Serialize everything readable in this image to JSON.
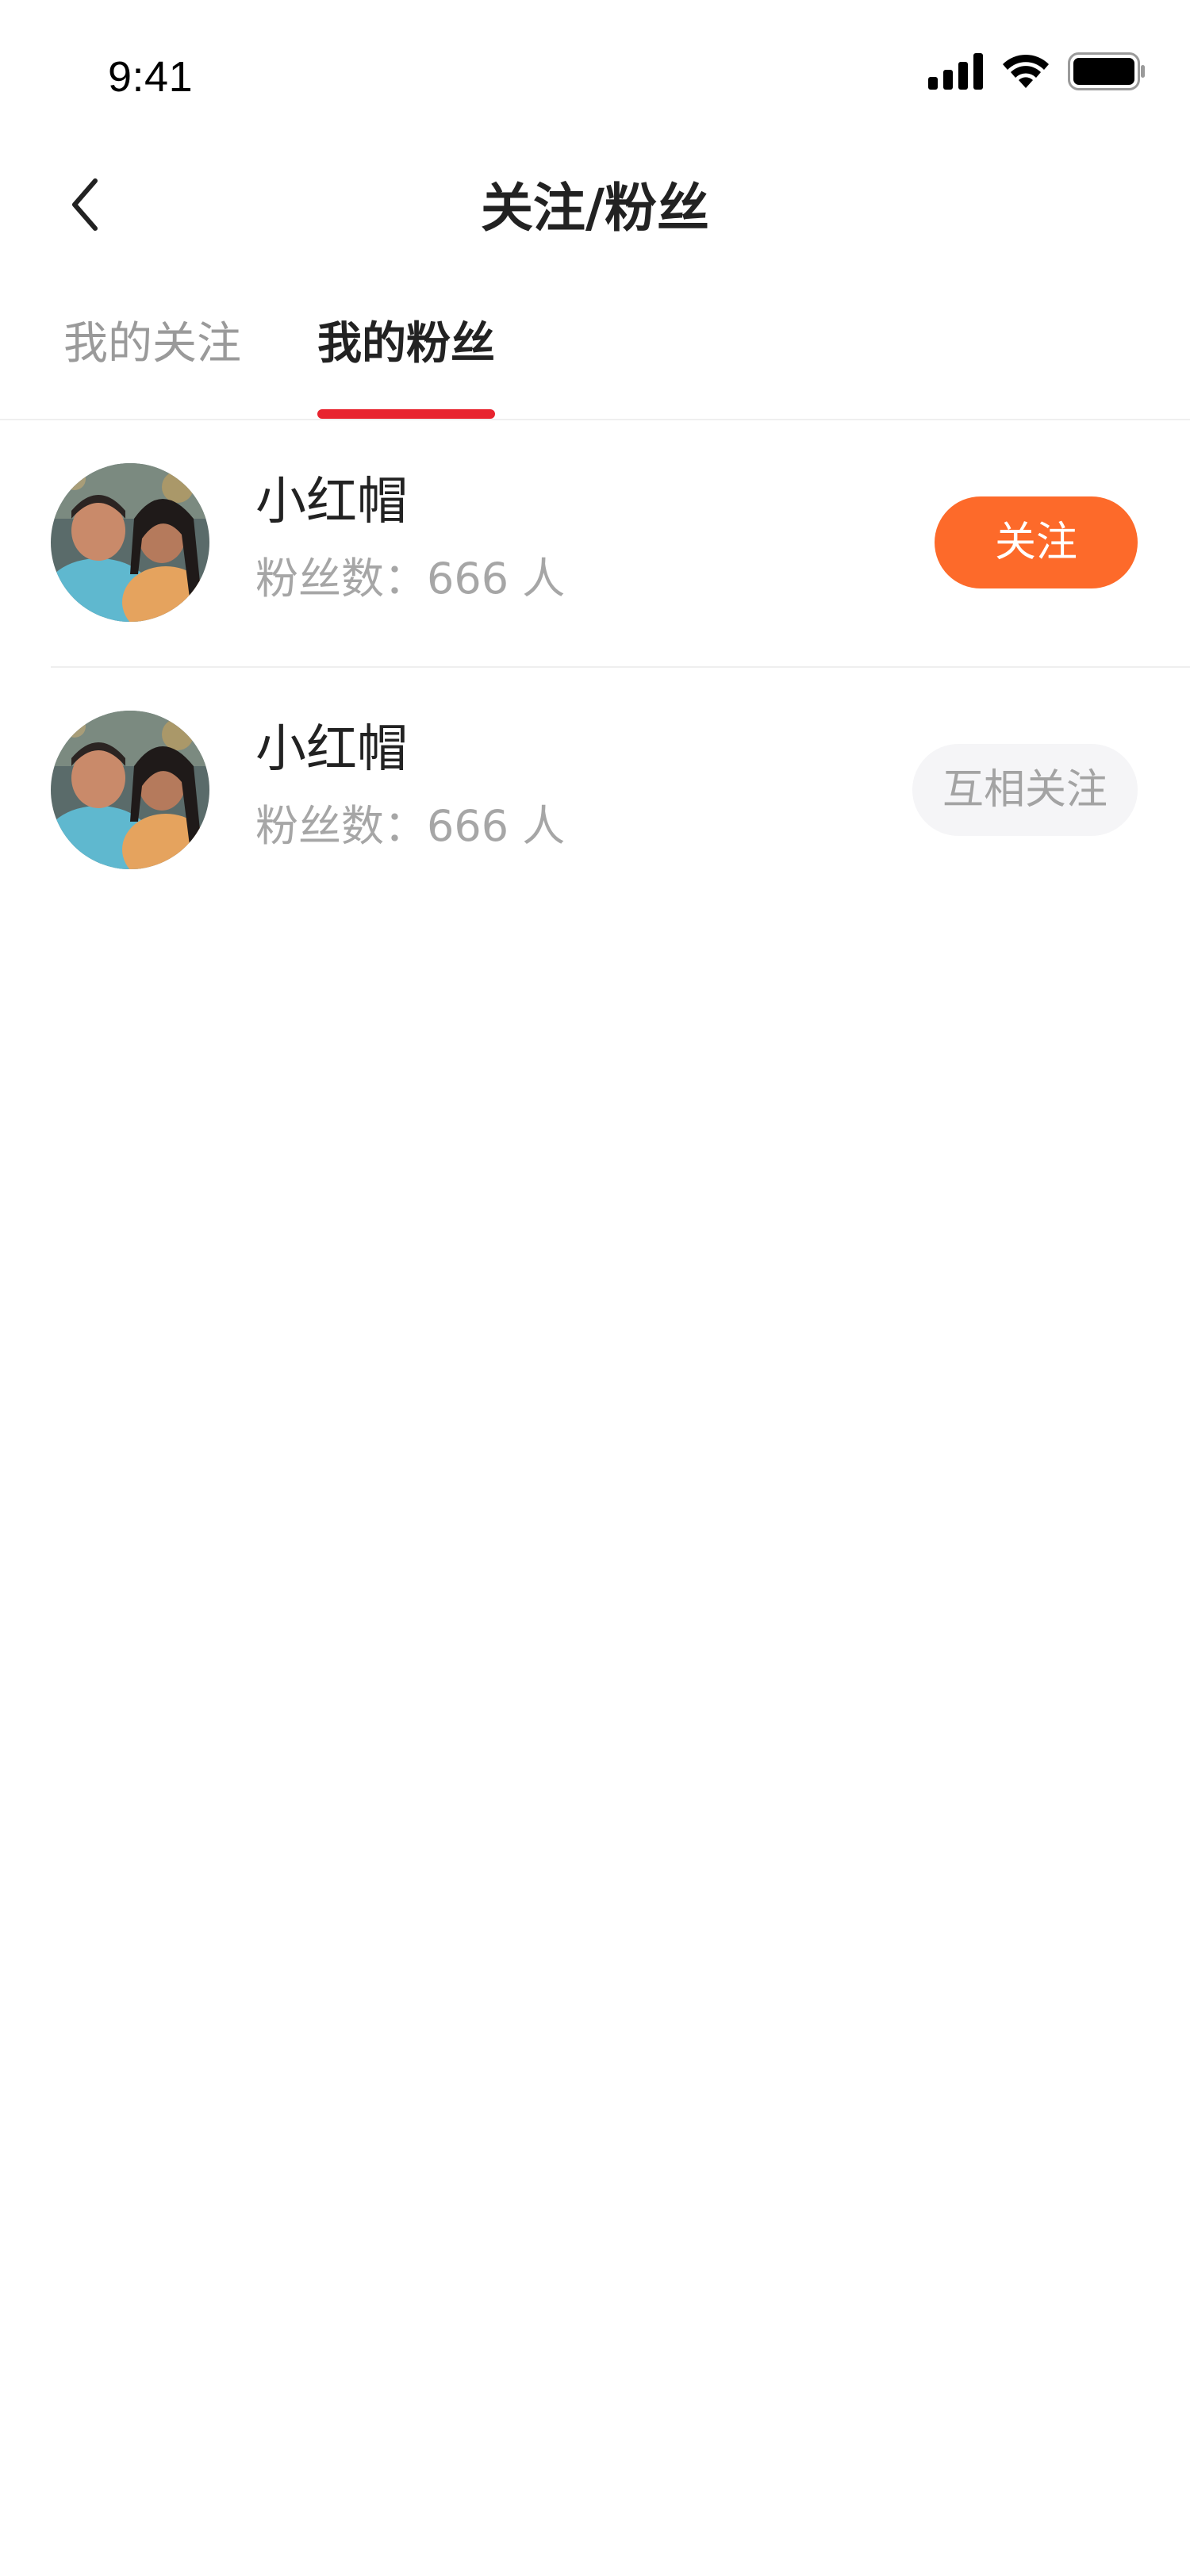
{
  "status_bar": {
    "time": "9:41",
    "icons": [
      "cellular-signal-icon",
      "wifi-icon",
      "battery-icon"
    ]
  },
  "nav": {
    "back_icon": "chevron-left-icon",
    "title": "关注/粉丝"
  },
  "tabs": [
    {
      "label": "我的关注",
      "active": false
    },
    {
      "label": "我的粉丝",
      "active": true
    }
  ],
  "colors": {
    "accent_indicator": "#e8242f",
    "follow_button": "#fd6a2a",
    "mutual_button_bg": "#f5f5f7",
    "secondary_text": "#a6a6a6"
  },
  "users": [
    {
      "name": "小红帽",
      "fans": "粉丝数：666 人",
      "action": "关注",
      "action_type": "follow"
    },
    {
      "name": "小红帽",
      "fans": "粉丝数：666 人",
      "action": "互相关注",
      "action_type": "mutual"
    }
  ]
}
